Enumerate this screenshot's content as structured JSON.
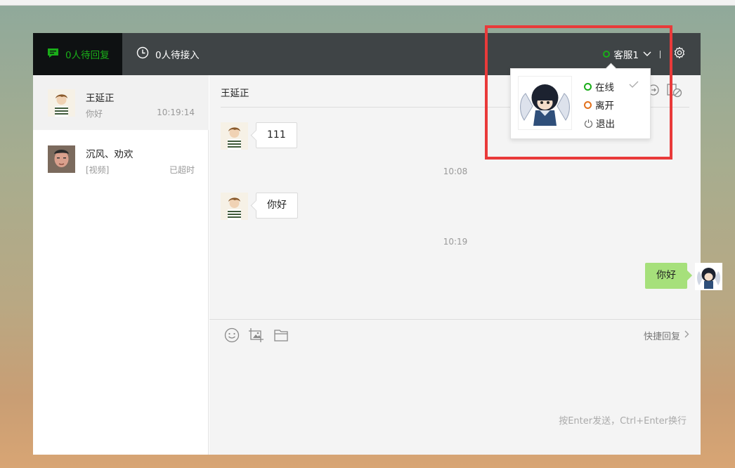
{
  "header": {
    "tab_waiting_reply": "0人待回复",
    "tab_waiting_accept": "0人待接入",
    "agent_name": "客服1",
    "status_color": "#1aad19",
    "accent": "#1aad19"
  },
  "sessions": [
    {
      "name": "王延正",
      "last_message": "你好",
      "time": "10:19:14",
      "active": true
    },
    {
      "name": "沉风、劝欢",
      "last_message": "[视频]",
      "time": "已超时",
      "active": false
    }
  ],
  "chat": {
    "contact_name": "王延正",
    "messages": [
      {
        "from": "customer",
        "text": "111"
      },
      {
        "timestamp": "10:08"
      },
      {
        "from": "customer",
        "text": "你好"
      },
      {
        "timestamp": "10:19"
      },
      {
        "from": "agent",
        "text": "你好"
      }
    ],
    "quick_reply_label": "快捷回复",
    "input_hint": "按Enter发送，Ctrl+Enter换行"
  },
  "status_menu": {
    "options": [
      {
        "label": "在线",
        "icon": "online-dot-icon",
        "selected": true
      },
      {
        "label": "离开",
        "icon": "away-dot-icon",
        "selected": false
      },
      {
        "label": "退出",
        "icon": "power-icon",
        "selected": false
      }
    ]
  },
  "icons": {
    "tab_waiting_reply": "chat-bubble-icon",
    "tab_waiting_accept": "clock-icon",
    "settings": "gear-icon",
    "emoji": "emoji-icon",
    "screenshot": "screenshot-icon",
    "file": "folder-icon"
  }
}
